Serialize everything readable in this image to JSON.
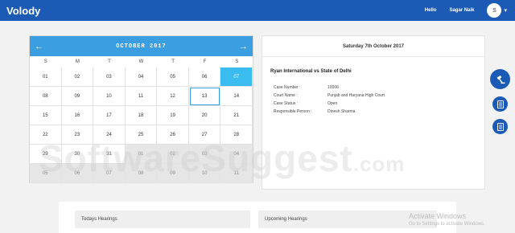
{
  "app": {
    "brand": "Volody"
  },
  "header": {
    "greeting": "Hello",
    "user_name": "Sagar Naik",
    "avatar_initial": "S"
  },
  "calendar": {
    "month_title": "OCTOBER 2017",
    "weekdays": [
      "S",
      "M",
      "T",
      "W",
      "T",
      "F",
      "S"
    ],
    "days": [
      {
        "label": "01",
        "state": "current"
      },
      {
        "label": "02",
        "state": "current"
      },
      {
        "label": "03",
        "state": "current"
      },
      {
        "label": "04",
        "state": "current"
      },
      {
        "label": "05",
        "state": "current"
      },
      {
        "label": "06",
        "state": "current"
      },
      {
        "label": "07",
        "state": "today"
      },
      {
        "label": "08",
        "state": "current"
      },
      {
        "label": "09",
        "state": "current"
      },
      {
        "label": "10",
        "state": "current"
      },
      {
        "label": "11",
        "state": "current"
      },
      {
        "label": "12",
        "state": "current"
      },
      {
        "label": "13",
        "state": "selected"
      },
      {
        "label": "14",
        "state": "current"
      },
      {
        "label": "15",
        "state": "current"
      },
      {
        "label": "16",
        "state": "current"
      },
      {
        "label": "17",
        "state": "current"
      },
      {
        "label": "18",
        "state": "current"
      },
      {
        "label": "19",
        "state": "current"
      },
      {
        "label": "20",
        "state": "current"
      },
      {
        "label": "21",
        "state": "current"
      },
      {
        "label": "22",
        "state": "current"
      },
      {
        "label": "23",
        "state": "current"
      },
      {
        "label": "24",
        "state": "current"
      },
      {
        "label": "25",
        "state": "current"
      },
      {
        "label": "26",
        "state": "current"
      },
      {
        "label": "27",
        "state": "current"
      },
      {
        "label": "28",
        "state": "current"
      },
      {
        "label": "29",
        "state": "current"
      },
      {
        "label": "30",
        "state": "current"
      },
      {
        "label": "31",
        "state": "current"
      },
      {
        "label": "01",
        "state": "other"
      },
      {
        "label": "02",
        "state": "other"
      },
      {
        "label": "03",
        "state": "other"
      },
      {
        "label": "04",
        "state": "other"
      },
      {
        "label": "05",
        "state": "other"
      },
      {
        "label": "06",
        "state": "other"
      },
      {
        "label": "07",
        "state": "other"
      },
      {
        "label": "08",
        "state": "other"
      },
      {
        "label": "09",
        "state": "other"
      },
      {
        "label": "10",
        "state": "other"
      },
      {
        "label": "11",
        "state": "other"
      }
    ]
  },
  "detail": {
    "date_heading": "Saturday 7th October 2017",
    "case_title": "Ryan International vs State of Delhi",
    "rows": [
      {
        "label": "Case Number :",
        "value": "10006"
      },
      {
        "label": "Court Name :",
        "value": "Punjab and Haryana High Court"
      },
      {
        "label": "Case Status :",
        "value": "Open"
      },
      {
        "label": "Responsible Person :",
        "value": "Dinesh Sharma"
      }
    ]
  },
  "fabs": [
    {
      "icon": "gavel-icon"
    },
    {
      "icon": "document-icon"
    },
    {
      "icon": "document-icon"
    }
  ],
  "hearings": {
    "today_label": "Todays Hearings",
    "upcoming_label": "Upcoming Hearings"
  },
  "watermark": {
    "main": "SoftwareSuggest",
    "suffix": ".com"
  },
  "activate": {
    "line1": "Activate Windows",
    "line2": "Go to Settings to activate Windows."
  },
  "colors": {
    "header": "#1c5bb5",
    "calendar_header": "#3b9ee0",
    "today": "#3bbcf0",
    "fab": "#1c5bb5"
  }
}
